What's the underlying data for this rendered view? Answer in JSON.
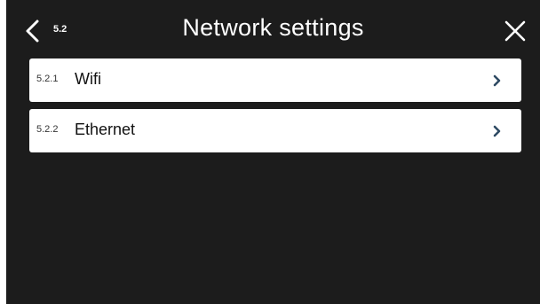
{
  "header": {
    "back_icon": "chevron-left-icon",
    "menu_number": "5.2",
    "title": "Network settings",
    "close_icon": "close-icon"
  },
  "menu": {
    "items": [
      {
        "number": "5.2.1",
        "label": "Wifi",
        "icon": "chevron-right-icon"
      },
      {
        "number": "5.2.2",
        "label": "Ethernet",
        "icon": "chevron-right-icon"
      }
    ]
  },
  "colors": {
    "background": "#1c1c1c",
    "item_background": "#ffffff",
    "chevron": "#2e4a63"
  }
}
